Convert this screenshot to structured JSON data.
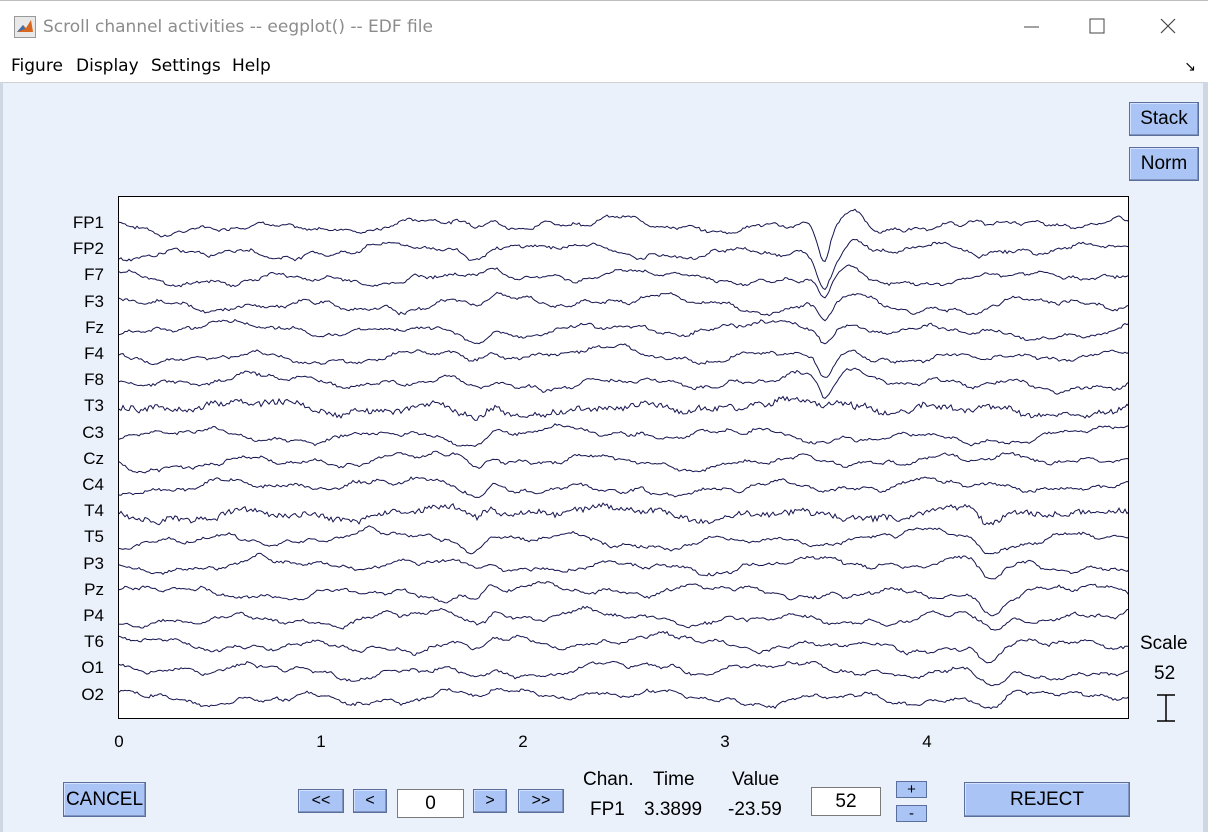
{
  "window": {
    "title": "Scroll channel activities -- eegplot() -- EDF file",
    "controls": [
      "minimize-icon",
      "maximize-icon",
      "close-icon"
    ]
  },
  "menu": [
    "Figure",
    "Display",
    "Settings",
    "Help"
  ],
  "buttons": {
    "stack": "Stack",
    "norm": "Norm",
    "cancel": "CANCEL",
    "reject": "REJECT",
    "first": "<<",
    "prev": "<",
    "next": ">",
    "last": ">>",
    "scale_up": "+",
    "scale_down": "-"
  },
  "scale": {
    "title": "Scale",
    "value": "52"
  },
  "nav": {
    "position": "0",
    "scale_input": "52"
  },
  "info": {
    "chan_label": "Chan.",
    "time_label": "Time",
    "value_label": "Value",
    "chan": "FP1",
    "time": "3.3899",
    "value": "-23.59"
  },
  "colors": {
    "trace": "#141450",
    "button": "#a9c4f5",
    "background": "#eaf1fb"
  },
  "chart_data": {
    "type": "line",
    "channels": [
      "FP1",
      "FP2",
      "F7",
      "F3",
      "Fz",
      "F4",
      "F8",
      "T3",
      "C3",
      "Cz",
      "C4",
      "T4",
      "T5",
      "P3",
      "Pz",
      "P4",
      "T6",
      "O1",
      "O2"
    ],
    "x_ticks": [
      "0",
      "1",
      "2",
      "3",
      "4"
    ],
    "xlim": [
      0,
      5
    ],
    "grid": false
  }
}
